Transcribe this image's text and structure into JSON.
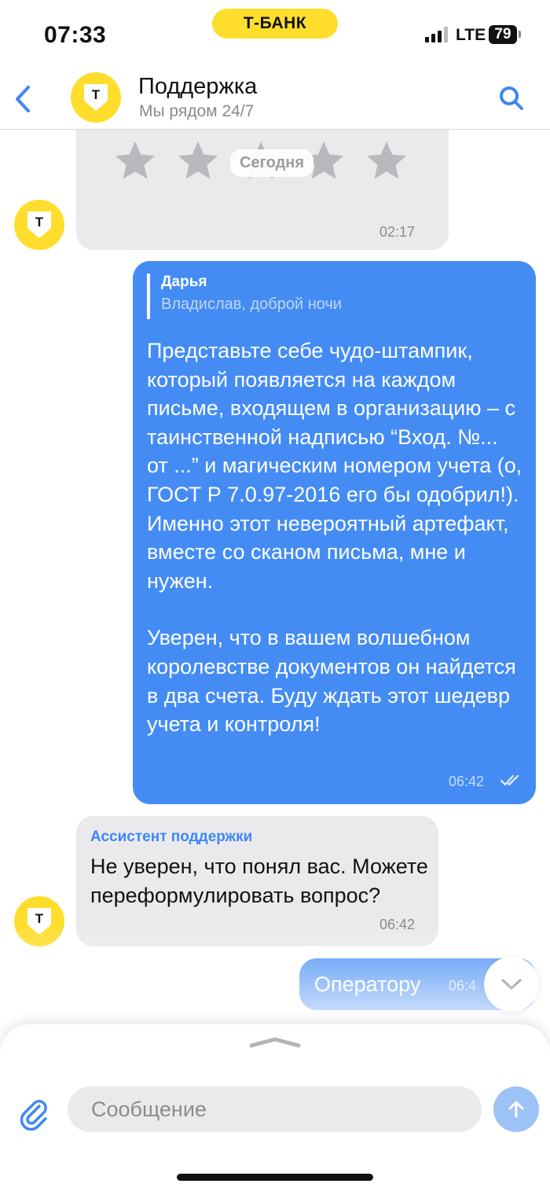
{
  "status_bar": {
    "time": "07:33",
    "carrier_badge": "Т-БАНК",
    "network": "LTE",
    "battery": "79"
  },
  "header": {
    "title": "Поддержка",
    "subtitle": "Мы рядом 24/7",
    "logo_letter": "Т"
  },
  "chat": {
    "rating_message": {
      "stars": 5,
      "time": "02:17"
    },
    "date_divider": "Сегодня",
    "user_message": {
      "quote_author": "Дарья",
      "quote_text": "Владислав, доброй ночи",
      "paragraph_1": "Представьте себе чудо-штампик, который появляется на каждом письме, входящем в организацию – с таинственной надписью “Вход. №... от ...” и магическим номером учета (о, ГОСТ Р 7.0.97-2016 его бы одобрил!). Именно этот невероятный артефакт, вместе со сканом письма, мне и нужен.",
      "paragraph_2": "Уверен, что в вашем волшебном королевстве документов он найдется в два счета. Буду ждать этот шедевр учета и контроля!",
      "time": "06:42",
      "status": "read"
    },
    "assistant_message": {
      "sender": "Ассистент поддержки",
      "text": "Не уверен, что понял вас. Можете переформулировать вопрос?",
      "time": "06:42"
    },
    "operator_message": {
      "text": "Оператору",
      "time": "06:4"
    }
  },
  "composer": {
    "placeholder": "Сообщение"
  },
  "colors": {
    "accent": "#448cf4",
    "brand_yellow": "#ffdd2d",
    "incoming_bubble": "#eaeaed"
  },
  "icons": [
    "back-arrow-icon",
    "search-icon",
    "star-icon",
    "double-check-icon",
    "chevron-down-icon",
    "paperclip-icon",
    "arrow-up-icon"
  ]
}
